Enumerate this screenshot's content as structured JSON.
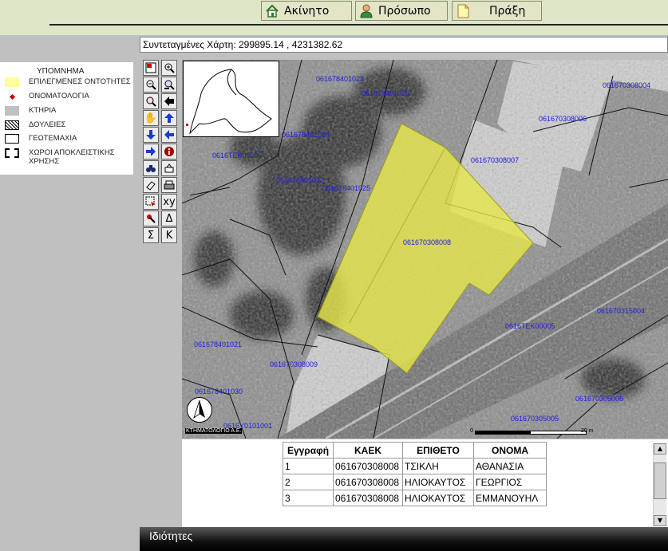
{
  "topnav": {
    "property_label": "Ακίνητο",
    "person_label": "Πρόσωπο",
    "deed_label": "Πράξη"
  },
  "coords": {
    "text": "Συντεταγμένες Χάρτη: 299895.14 , 4231382.62"
  },
  "legend": {
    "title": "ΥΠΟΜΝΗΜΑ",
    "items": [
      {
        "label": "ΕΠΙΛΕΓΜΕΝΕΣ ΟΝΤΟΤΗΤΕΣ",
        "color": "#ffff99"
      },
      {
        "label": "ΟΝΟΜΑΤΟΛΟΓΙΑ",
        "color": "#cc0000"
      },
      {
        "label": "ΚΤΗΡΙΑ",
        "color": "#c0c0c0"
      },
      {
        "label": "ΔΟΥΛΕΙΕΣ"
      },
      {
        "label": "ΓΕΩΤΕΜΑΧΙΑ"
      },
      {
        "label": "ΧΩΡΟΙ ΑΠΟΚΛΕΙΣΤΙΚΗΣ ΧΡΗΣΗΣ"
      }
    ]
  },
  "tools": {
    "xy_label": "xy",
    "delta_label": "Δ",
    "sigma_label": "Σ",
    "kappa_label": "K"
  },
  "map": {
    "parcel_labels": [
      "061678401023",
      "061678401020",
      "061670308004",
      "061670308006",
      "061678401024",
      "061670308007",
      "0616ΤΕΚ00206",
      "061678401022",
      "061678401025",
      "061670308008",
      "061678401021",
      "0616ΤΕΚ00005",
      "061670315004",
      "061670308009",
      "061678401030",
      "061670305006",
      "061670305005",
      "0616Υ0101001"
    ],
    "credit": "ΚΤΗΜΑΤΟΛΟΓΙΟ Α.Ε.",
    "scale_start": "0",
    "scale_end": "20 m",
    "selection_color": "#e6e64a"
  },
  "table": {
    "headers": [
      "Εγγραφή",
      "ΚΑΕΚ",
      "ΕΠΙΘΕΤΟ",
      "ΟΝΟΜΑ"
    ],
    "rows": [
      [
        "1",
        "061670308008",
        "ΤΣΙΚΛΗ",
        "ΑΘΑΝΑΣΙΑ"
      ],
      [
        "2",
        "061670308008",
        "ΗΛΙΟΚΑΥΤΟΣ",
        "ΓΕΩΡΓΙΟΣ"
      ],
      [
        "3",
        "061670308008",
        "ΗΛΙΟΚΑΥΤΟΣ",
        "ΕΜΜΑΝΟΥΗΛ"
      ]
    ]
  },
  "footer": {
    "title": "Ιδιότητες"
  }
}
